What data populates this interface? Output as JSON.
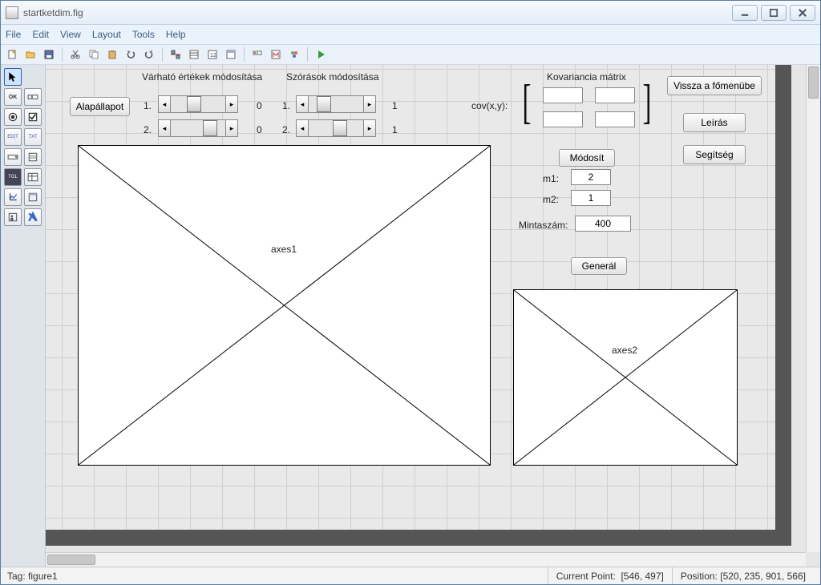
{
  "window": {
    "title": "startketdim.fig"
  },
  "menu": {
    "items": [
      "File",
      "Edit",
      "View",
      "Layout",
      "Tools",
      "Help"
    ]
  },
  "toolbar_icons": [
    "new-file-icon",
    "open-icon",
    "save-icon",
    "cut-icon",
    "copy-icon",
    "paste-icon",
    "undo-icon",
    "redo-icon",
    "align-icon",
    "props-icon",
    "tab-order-icon",
    "menu-editor-icon",
    "toolbar-editor-icon",
    "mcode-icon",
    "editor-icon",
    "run-icon"
  ],
  "palette_icons": [
    [
      "pointer-icon",
      ""
    ],
    [
      "ok-icon",
      "checkbox-icon"
    ],
    [
      "radio-icon",
      "check-icon"
    ],
    [
      "edit-icon",
      "text-icon"
    ],
    [
      "panel-icon",
      "list-icon"
    ],
    [
      "toggle-icon",
      "table-icon"
    ],
    [
      "axes-icon",
      "group-icon"
    ],
    [
      "tab-icon",
      "activex-icon"
    ]
  ],
  "canvas": {
    "default_button": "Alapállapot",
    "expected_title": "Várható értékek módosítása",
    "std_title": "Szórások módosítása",
    "row1_label": "1.",
    "row2_label": "2.",
    "exp1_val": "0",
    "exp2_val": "0",
    "std1_val": "1",
    "std2_val": "1",
    "cov_title": "Kovariancia mátrix",
    "cov_label": "cov(x,y):",
    "modify_button": "Módosít",
    "m1_label": "m1:",
    "m1_value": "2",
    "m2_label": "m2:",
    "m2_value": "1",
    "sample_label": "Mintaszám:",
    "sample_value": "400",
    "generate_button": "Generál",
    "back_button": "Vissza a főmenübe",
    "desc_button": "Leírás",
    "help_button": "Segítség",
    "axes1": "axes1",
    "axes2": "axes2"
  },
  "status": {
    "tag_label": "Tag:",
    "tag_value": "figure1",
    "cp_label": "Current Point:",
    "cp_value": "[546, 497]",
    "pos_label": "Position:",
    "pos_value": "[520, 235, 901, 566]"
  }
}
